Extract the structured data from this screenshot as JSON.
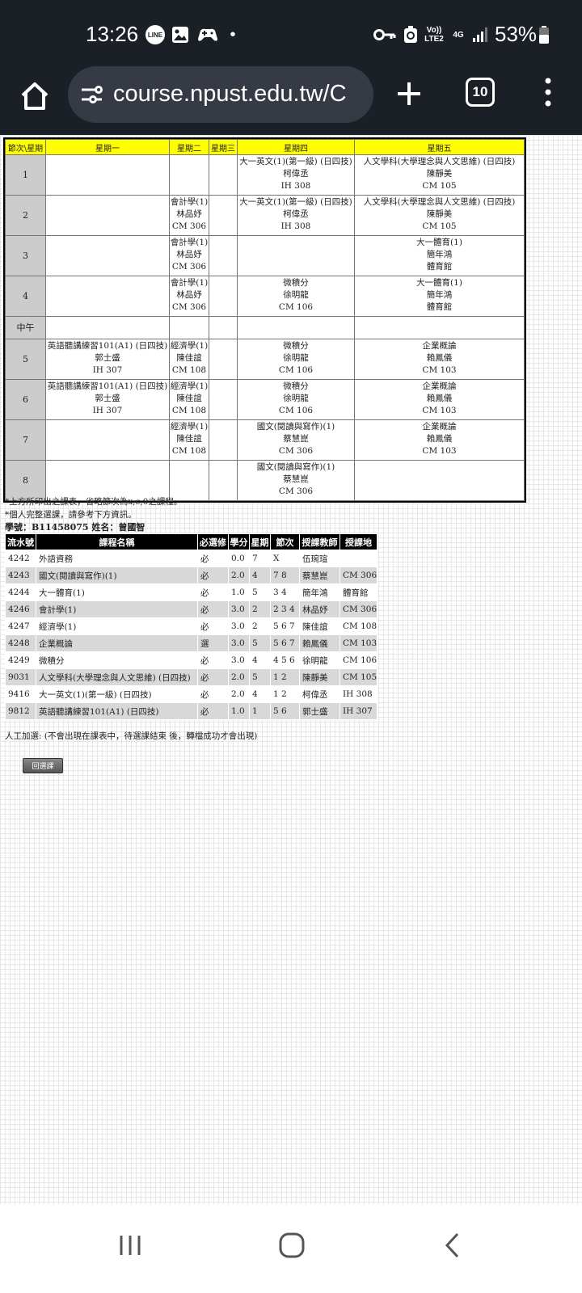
{
  "status_bar": {
    "time": "13:26",
    "dot": "•",
    "volte": "Vo)) LTE2",
    "network": "4G",
    "battery": "53%"
  },
  "browser": {
    "url": "course.npust.edu.tw/C",
    "tab_count": "10"
  },
  "schedule": {
    "headers": [
      "節次\\星期",
      "星期一",
      "星期二",
      "星期三",
      "星期四",
      "星期五"
    ],
    "rows": [
      {
        "period": "1",
        "cells": [
          [],
          [],
          [],
          [
            "大一英文(1)(第一級) (日四技)",
            "柯偉丞",
            "IH 308"
          ],
          [
            "人文學科(大學理念與人文思維) (日四技)",
            "陳靜美",
            "CM 105"
          ]
        ]
      },
      {
        "period": "2",
        "cells": [
          [],
          [
            "會計學(1)",
            "林品妤",
            "CM 306"
          ],
          [],
          [
            "大一英文(1)(第一級) (日四技)",
            "柯偉丞",
            "IH 308"
          ],
          [
            "人文學科(大學理念與人文思維) (日四技)",
            "陳靜美",
            "CM 105"
          ]
        ]
      },
      {
        "period": "3",
        "cells": [
          [],
          [
            "會計學(1)",
            "林品妤",
            "CM 306"
          ],
          [],
          [],
          [
            "大一體育(1)",
            "簡年鴻",
            "體育館"
          ]
        ]
      },
      {
        "period": "4",
        "cells": [
          [],
          [
            "會計學(1)",
            "林品妤",
            "CM 306"
          ],
          [],
          [
            "微積分",
            "徐明龍",
            "CM 106"
          ],
          [
            "大一體育(1)",
            "簡年鴻",
            "體育館"
          ]
        ]
      },
      {
        "period": "中午",
        "cells": [
          [],
          [],
          [],
          [],
          []
        ]
      },
      {
        "period": "5",
        "cells": [
          [
            "英語聽講練習101(A1) (日四技)",
            "郭士盛",
            "IH 307"
          ],
          [
            "經濟學(1)",
            "陳佳誼",
            "CM 108"
          ],
          [],
          [
            "微積分",
            "徐明龍",
            "CM 106"
          ],
          [
            "企業概論",
            "賴鳳儀",
            "CM 103"
          ]
        ]
      },
      {
        "period": "6",
        "cells": [
          [
            "英語聽講練習101(A1) (日四技)",
            "郭士盛",
            "IH 307"
          ],
          [
            "經濟學(1)",
            "陳佳誼",
            "CM 108"
          ],
          [],
          [
            "微積分",
            "徐明龍",
            "CM 106"
          ],
          [
            "企業概論",
            "賴鳳儀",
            "CM 103"
          ]
        ]
      },
      {
        "period": "7",
        "cells": [
          [],
          [
            "經濟學(1)",
            "陳佳誼",
            "CM 108"
          ],
          [],
          [
            "國文(閱讀與寫作)(1)",
            "蔡慧崑",
            "CM 306"
          ],
          [
            "企業概論",
            "賴鳳儀",
            "CM 103"
          ]
        ]
      },
      {
        "period": "8",
        "cells": [
          [],
          [],
          [],
          [
            "國文(閱讀與寫作)(1)",
            "蔡慧崑",
            "CM 306"
          ],
          []
        ]
      }
    ]
  },
  "notes": {
    "note1": "*上方所印出之課表，省略節次為x,c,0之課程。",
    "note2": "*個人完整選課，請參考下方資訊。",
    "student_info": "學號：B11458075 姓名：曾國智"
  },
  "course_list": {
    "headers": [
      "流水號",
      "課程名稱",
      "必選修",
      "學分",
      "星期",
      "節次",
      "授課教師",
      "授課地"
    ],
    "rows": [
      [
        "4242",
        "外語資務",
        "必",
        "0.0",
        "7",
        "X",
        "伍琬瑄",
        ""
      ],
      [
        "4243",
        "國文(閱讀與寫作)(1)",
        "必",
        "2.0",
        "4",
        "7 8",
        "蔡慧崑",
        "CM 306"
      ],
      [
        "4244",
        "大一體育(1)",
        "必",
        "1.0",
        "5",
        "3 4",
        "簡年鴻",
        "體育館"
      ],
      [
        "4246",
        "會計學(1)",
        "必",
        "3.0",
        "2",
        "2 3 4",
        "林品妤",
        "CM 306"
      ],
      [
        "4247",
        "經濟學(1)",
        "必",
        "3.0",
        "2",
        "5 6 7",
        "陳佳誼",
        "CM 108"
      ],
      [
        "4248",
        "企業概論",
        "選",
        "3.0",
        "5",
        "5 6 7",
        "賴鳳儀",
        "CM 103"
      ],
      [
        "4249",
        "微積分",
        "必",
        "3.0",
        "4",
        "4 5 6",
        "徐明龍",
        "CM 106"
      ],
      [
        "9031",
        "人文學科(大學理念與人文思維) (日四技)",
        "必",
        "2.0",
        "5",
        "1 2",
        "陳靜美",
        "CM 105"
      ],
      [
        "9416",
        "大一英文(1)(第一級) (日四技)",
        "必",
        "2.0",
        "4",
        "1 2",
        "柯偉丞",
        "IH 308"
      ],
      [
        "9812",
        "英語聽講練習101(A1) (日四技)",
        "必",
        "1.0",
        "1",
        "5 6",
        "郭士盛",
        "IH 307"
      ]
    ]
  },
  "manual_add": "人工加選: (不會出現在課表中，待選課結束 後，轉檔成功才會出現)",
  "back_button": "回選課",
  "colors": {
    "header_yellow": "#ffff00",
    "period_gray": "#cccccc",
    "list_header": "#000000",
    "topbar": "#1b1f26"
  },
  "icons": [
    "home-icon",
    "tune-icon",
    "plus-icon",
    "tabs-icon",
    "more-vert-icon",
    "recents-icon",
    "nav-home-icon",
    "back-icon"
  ]
}
